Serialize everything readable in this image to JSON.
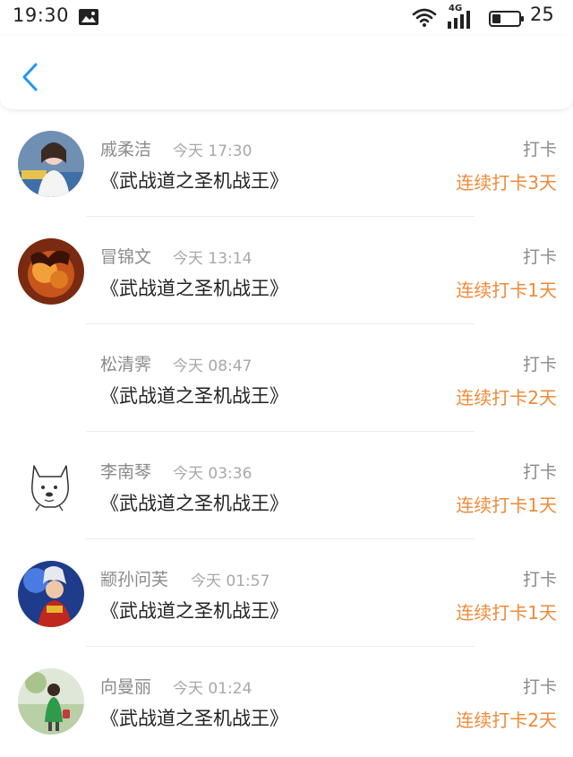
{
  "status_bar": {
    "time": "19:30",
    "network": "4G",
    "battery": "25",
    "icons": [
      "photo-icon",
      "wifi-icon",
      "signal-icon",
      "battery-icon"
    ]
  },
  "header": {
    "back_icon": "chevron-left-icon",
    "accent_color": "#2196f3"
  },
  "colors": {
    "streak": "#f08a38",
    "name": "#8a8a8a",
    "title": "#222222"
  },
  "entries": [
    {
      "name": "戚柔洁",
      "time": "今天 17:30",
      "title": "《武战道之圣机战王》",
      "action": "打卡",
      "streak": "连续打卡3天"
    },
    {
      "name": "冒锦文",
      "time": "今天 13:14",
      "title": "《武战道之圣机战王》",
      "action": "打卡",
      "streak": "连续打卡1天"
    },
    {
      "name": "松清霁",
      "time": "今天 08:47",
      "title": "《武战道之圣机战王》",
      "action": "打卡",
      "streak": "连续打卡2天"
    },
    {
      "name": "李南琴",
      "time": "今天 03:36",
      "title": "《武战道之圣机战王》",
      "action": "打卡",
      "streak": "连续打卡1天"
    },
    {
      "name": "颛孙问芙",
      "time": "今天 01:57",
      "title": "《武战道之圣机战王》",
      "action": "打卡",
      "streak": "连续打卡1天"
    },
    {
      "name": "向曼丽",
      "time": "今天 01:24",
      "title": "《武战道之圣机战王》",
      "action": "打卡",
      "streak": "连续打卡2天"
    }
  ]
}
